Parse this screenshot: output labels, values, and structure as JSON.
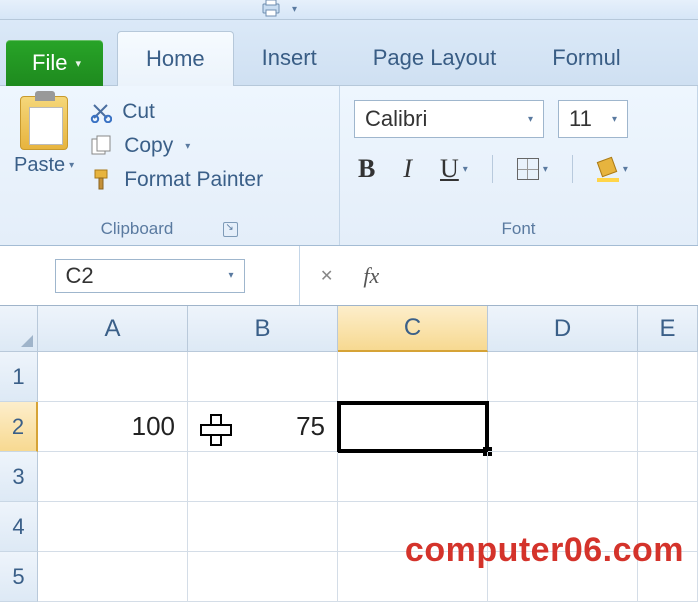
{
  "qat": {
    "shortcut_hint": ""
  },
  "tabs": {
    "file": "File",
    "items": [
      "Home",
      "Insert",
      "Page Layout",
      "Formul"
    ]
  },
  "ribbon": {
    "clipboard": {
      "label": "Clipboard",
      "paste": "Paste",
      "cut": "Cut",
      "copy": "Copy",
      "format_painter": "Format Painter"
    },
    "font": {
      "label": "Font",
      "name": "Calibri",
      "size": "11",
      "bold": "B",
      "italic": "I",
      "underline": "U"
    }
  },
  "formula_bar": {
    "name_box": "C2",
    "cancel": "✕",
    "fx": "fx",
    "value": ""
  },
  "grid": {
    "columns": [
      "A",
      "B",
      "C",
      "D",
      "E"
    ],
    "selected_col_index": 2,
    "rows": [
      "1",
      "2",
      "3",
      "4",
      "5"
    ],
    "selected_row_index": 1,
    "cells": {
      "A2": "100",
      "B2": "75"
    },
    "active_cell": "C2"
  },
  "watermark": "computer06.com"
}
